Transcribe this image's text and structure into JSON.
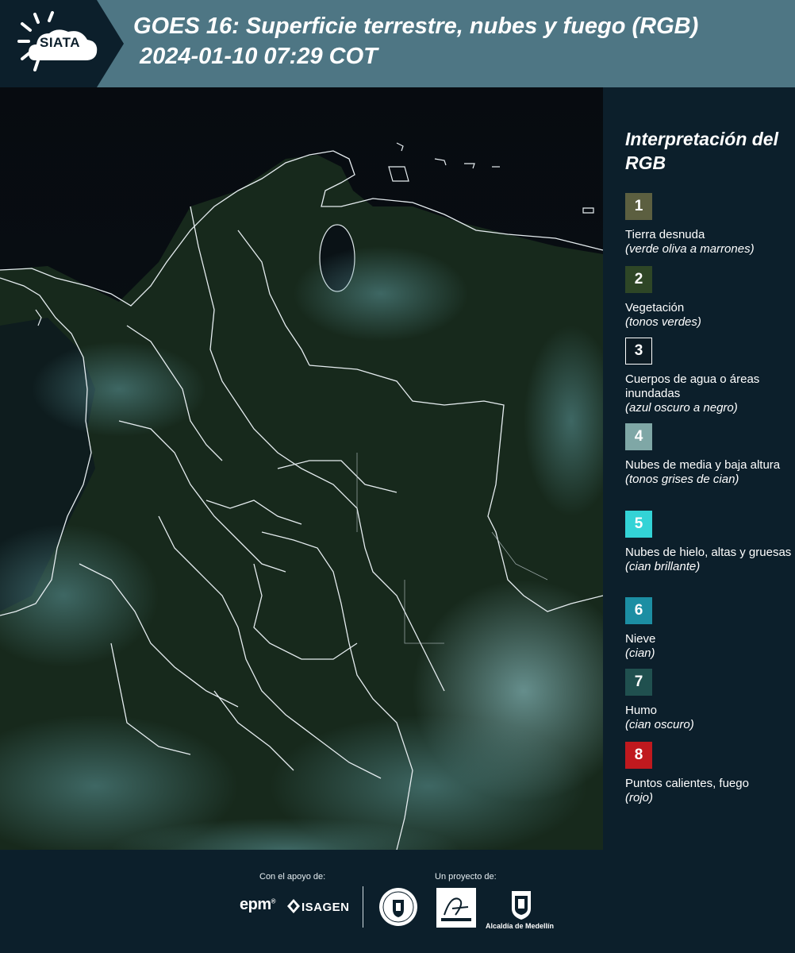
{
  "header": {
    "logo_text": "SIATA",
    "title_line1": "GOES 16: Superficie terrestre, nubes y fuego (RGB)",
    "title_line2": "2024-01-10 07:29 COT"
  },
  "legend": {
    "title": "Interpretación del RGB",
    "items": [
      {
        "number": "1",
        "label": "Tierra desnuda",
        "note": "(verde oliva a marrones)",
        "color": "#5c5f40"
      },
      {
        "number": "2",
        "label": "Vegetación",
        "note": "(tonos verdes)",
        "color": "#2e4626"
      },
      {
        "number": "3",
        "label": "Cuerpos de agua o áreas inundadas",
        "note": "(azul oscuro a negro)",
        "color": "#0d1b24"
      },
      {
        "number": "4",
        "label": "Nubes de media y baja altura",
        "note": "(tonos grises de cian)",
        "color": "#7fa7a6"
      },
      {
        "number": "5",
        "label": "Nubes de hielo, altas y gruesas",
        "note": "(cian brillante)",
        "color": "#33d3d6"
      },
      {
        "number": "6",
        "label": "Nieve",
        "note": "(cian)",
        "color": "#1c8ea3"
      },
      {
        "number": "7",
        "label": "Humo",
        "note": "(cian oscuro)",
        "color": "#20504f"
      },
      {
        "number": "8",
        "label": "Puntos calientes, fuego",
        "note": "(rojo)",
        "color": "#c0191e"
      }
    ]
  },
  "footer": {
    "support_label": "Con el apoyo de:",
    "project_label": "Un proyecto de:",
    "epm": "epm",
    "isagen": "ISAGEN",
    "medellin": "Alcaldía de Medellín"
  }
}
